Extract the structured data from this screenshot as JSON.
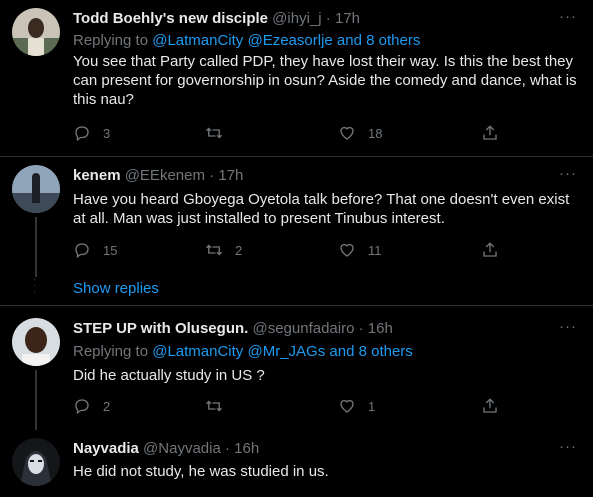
{
  "colors": {
    "background": "#000000",
    "text": "#e7e9ea",
    "secondary": "#71767b",
    "accent": "#1d9bf0"
  },
  "tweets": [
    {
      "name": "Todd Boehly's new disciple",
      "handle": "@ihyi_j",
      "sep": "·",
      "time": "17h",
      "replying_prefix": "Replying to",
      "replying_users": "@LatmanCity @Ezeasorlje",
      "replying_and": "and",
      "replying_others": "8 others",
      "text": "You see that Party called PDP, they have lost their way. Is this the best they can present for governorship in osun? Aside the comedy and dance, what is this nau?",
      "replies": "3",
      "retweets": "",
      "likes": "18"
    },
    {
      "name": "kenem",
      "handle": "@EEkenem",
      "sep": "·",
      "time": "17h",
      "text": "Have you heard Gboyega Oyetola talk before? That one doesn't even exist at all. Man was just installed to present Tinubus interest.",
      "replies": "15",
      "retweets": "2",
      "likes": "11"
    },
    {
      "name": "STEP UP with Olusegun.",
      "handle": "@segunfadairo",
      "sep": "·",
      "time": "16h",
      "replying_prefix": "Replying to",
      "replying_users": "@LatmanCity @Mr_JAGs",
      "replying_and": "and",
      "replying_others": "8 others",
      "text": "Did he actually study in US ?",
      "replies": "2",
      "retweets": "",
      "likes": "1"
    },
    {
      "name": "Nayvadia",
      "handle": "@Nayvadia",
      "sep": "·",
      "time": "16h",
      "text": "He did not study, he was studied in us."
    }
  ],
  "show_replies": "Show replies",
  "more_glyph": "···",
  "icons": {
    "reply": "reply-icon",
    "retweet": "retweet-icon",
    "like": "like-icon",
    "share": "share-icon"
  }
}
